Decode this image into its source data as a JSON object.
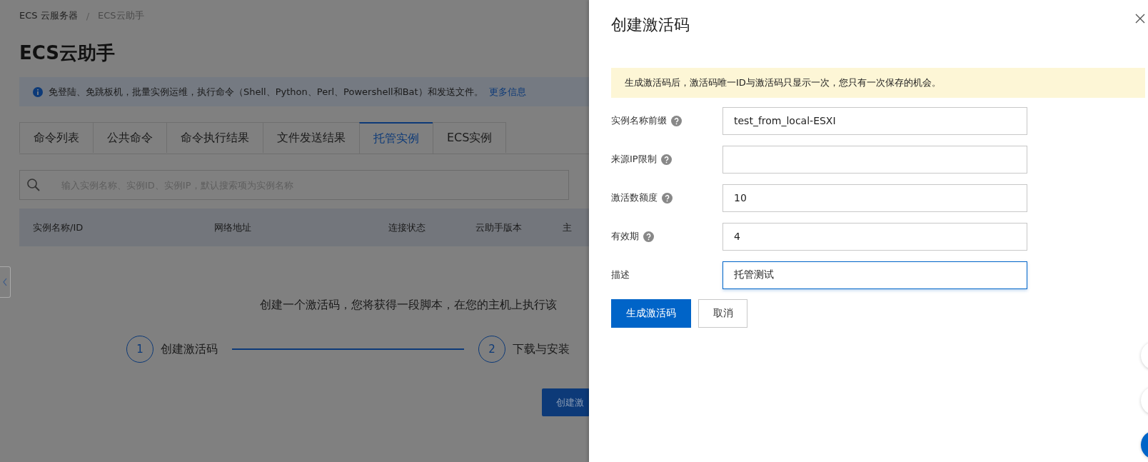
{
  "breadcrumb": [
    "ECS 云服务器",
    "ECS云助手"
  ],
  "breadcrumb_separator": "/",
  "page_title": "ECS云助手",
  "info": {
    "text": "免登陆、免跳板机，批量实例运维，执行命令（Shell、Python、Perl、Powershell和Bat）和发送文件。",
    "link": "更多信息"
  },
  "tabs": [
    {
      "label": "命令列表",
      "selected": false
    },
    {
      "label": "公共命令",
      "selected": false
    },
    {
      "label": "命令执行结果",
      "selected": false
    },
    {
      "label": "文件发送结果",
      "selected": false
    },
    {
      "label": "托管实例",
      "selected": true
    },
    {
      "label": "ECS实例",
      "selected": false
    }
  ],
  "search": {
    "placeholder": "输入实例名称、实例ID、实例IP，默认搜索项为实例名称"
  },
  "table": {
    "columns": [
      "实例名称/ID",
      "网络地址",
      "连接状态",
      "云助手版本",
      "主"
    ]
  },
  "intro_text": "创建一个激活码，您将获得一段脚本，在您的主机上执行该",
  "steps": [
    {
      "number": "1",
      "label": "创建激活码"
    },
    {
      "number": "2",
      "label": "下载与安装"
    }
  ],
  "create_button": "创建激",
  "drawer": {
    "title": "创建激活码",
    "notice": "生成激活码后，激活码唯一ID与激活码只显示一次，您只有一次保存的机会。",
    "fields": [
      {
        "label": "实例名称前缀",
        "help": true,
        "value": "test_from_local-ESXI",
        "focused": false
      },
      {
        "label": "来源IP限制",
        "help": true,
        "focused": false
      },
      {
        "label": "激活数额度",
        "help": true,
        "value": "10",
        "focused": false
      },
      {
        "label": "有效期",
        "help": true,
        "value": "4",
        "focused": false
      },
      {
        "label": "描述",
        "help": false,
        "value": "托管测试",
        "focused": true
      }
    ],
    "primary_button": "生成激活码",
    "cancel_button": "取消"
  }
}
